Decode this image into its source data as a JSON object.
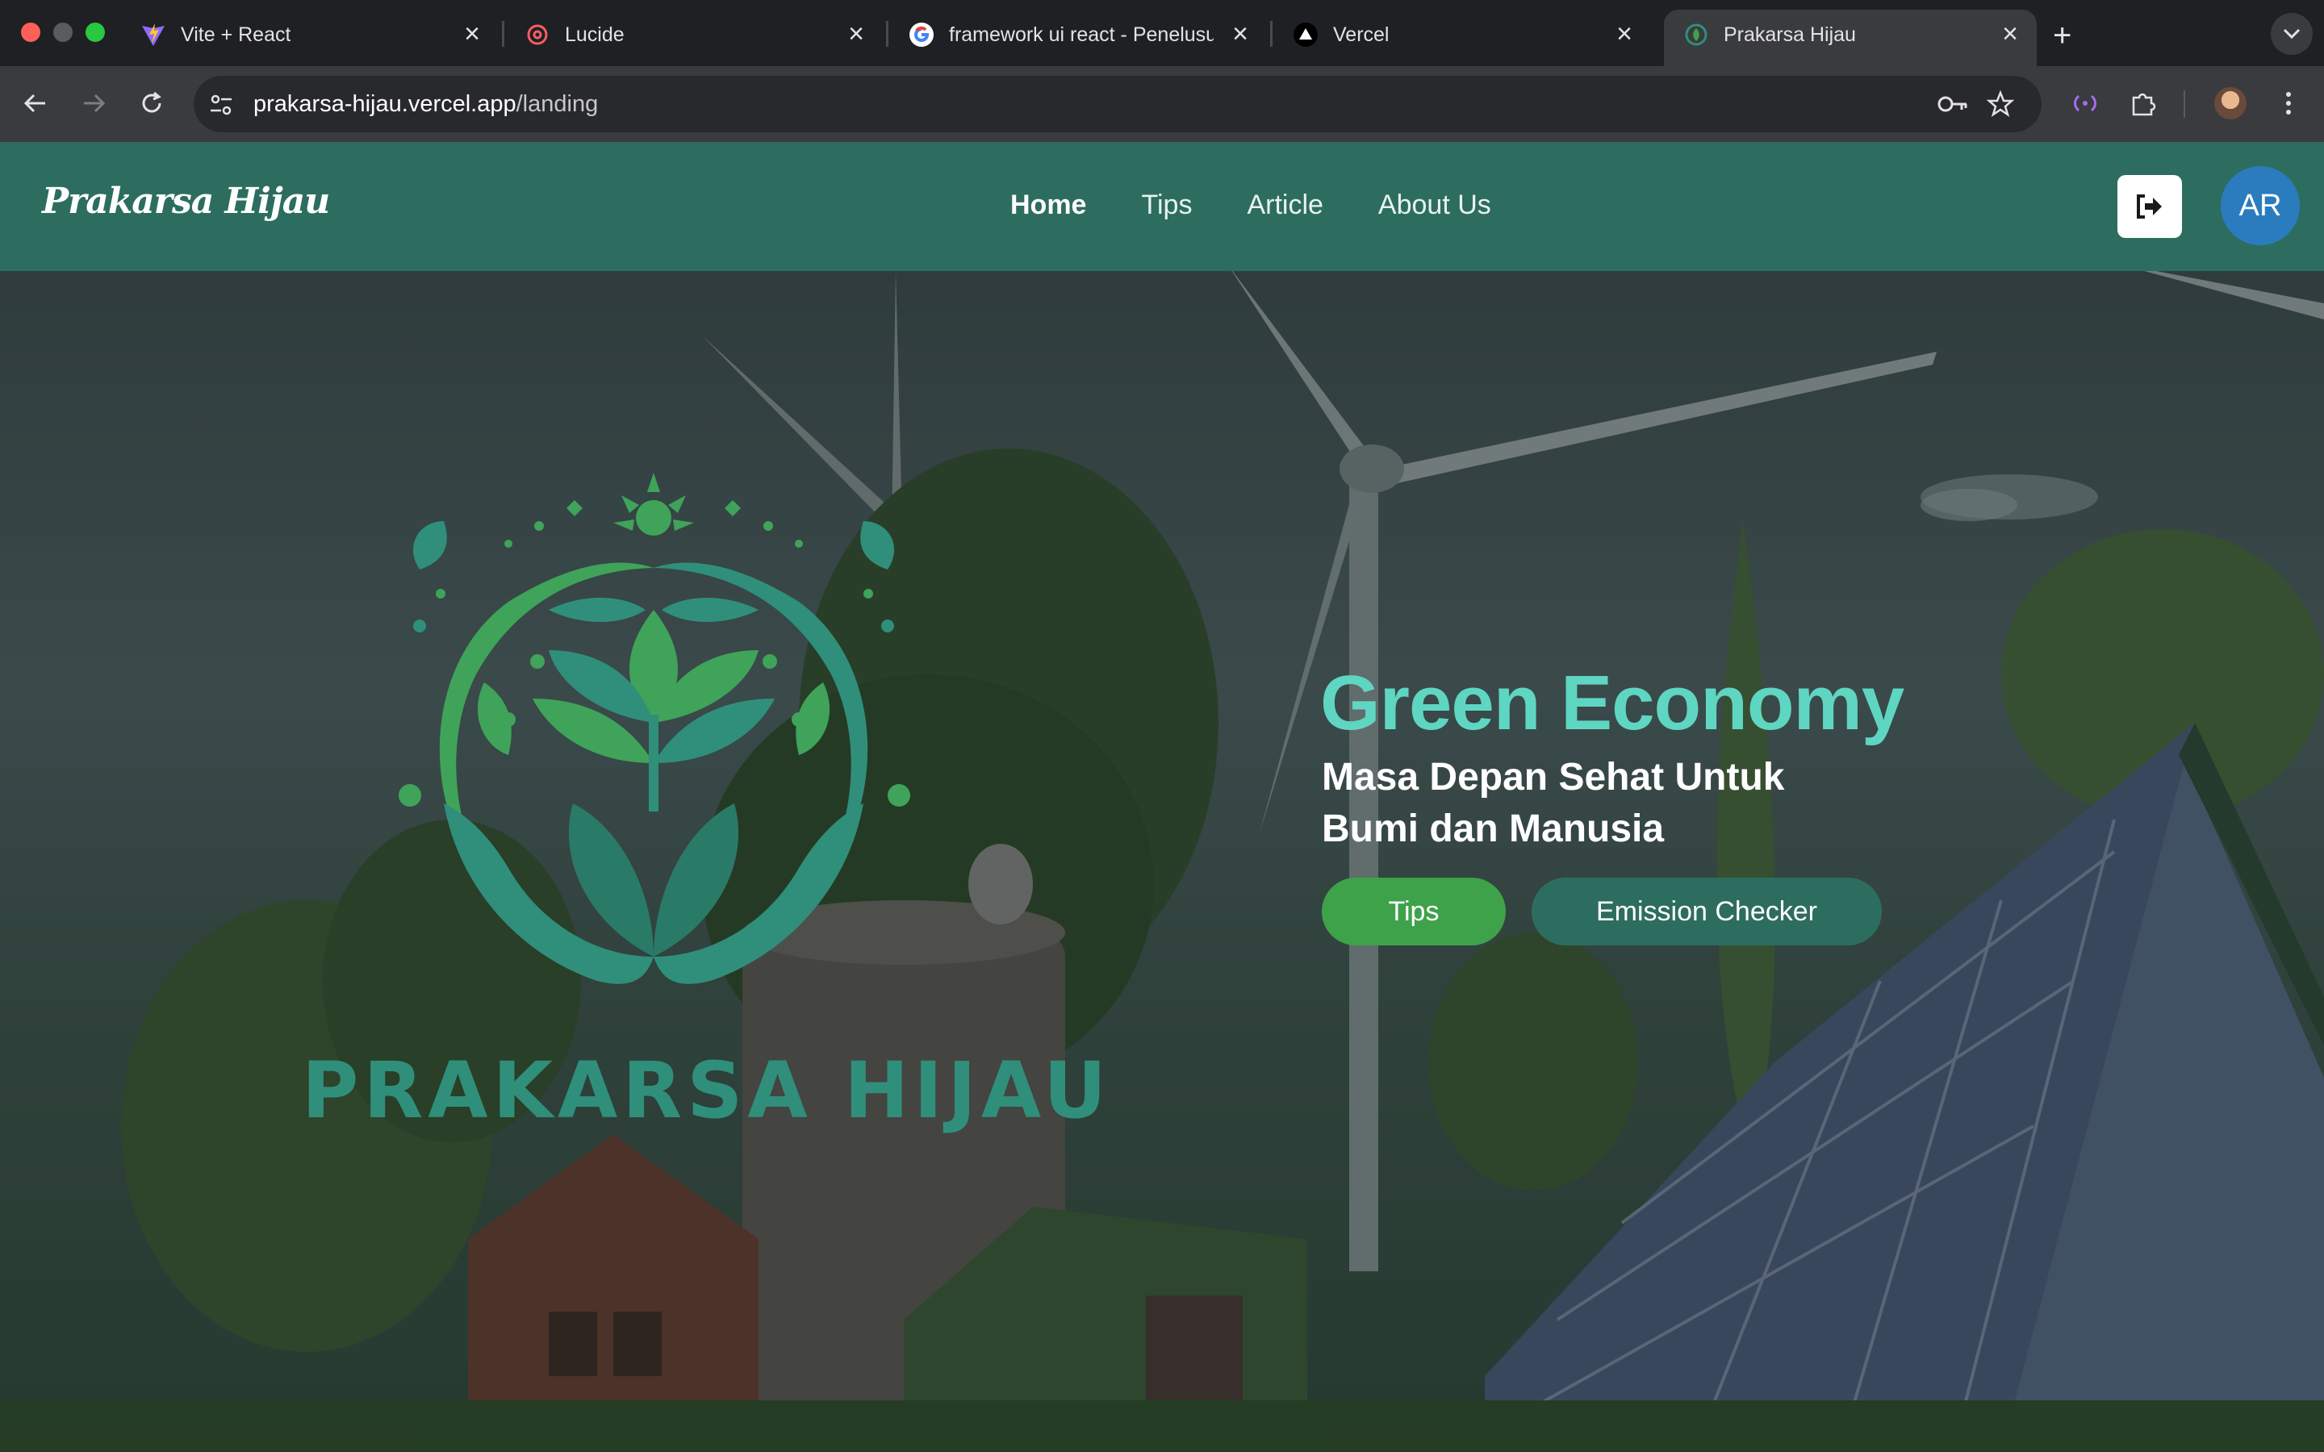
{
  "browser": {
    "tabs": [
      {
        "title": "Vite + React",
        "icon": "vite-icon",
        "active": false
      },
      {
        "title": "Lucide",
        "icon": "lucide-icon",
        "active": false
      },
      {
        "title": "framework ui react - Penelusuran Google",
        "icon": "google-icon",
        "active": false
      },
      {
        "title": "Vercel",
        "icon": "vercel-icon",
        "active": false
      },
      {
        "title": "Prakarsa Hijau",
        "icon": "prakarsa-hijau-favicon",
        "active": true
      }
    ],
    "url_host": "prakarsa-hijau.vercel.app",
    "url_path": "/landing"
  },
  "header": {
    "brand": "Prakarsa Hijau",
    "nav": [
      {
        "label": "Home",
        "active": true
      },
      {
        "label": "Tips",
        "active": false
      },
      {
        "label": "Article",
        "active": false
      },
      {
        "label": "About Us",
        "active": false
      }
    ],
    "avatar_initials": "AR",
    "logout_icon": "logout-icon",
    "colors": {
      "header_bg": "#2d6d5f",
      "avatar_bg": "#2b7cbf"
    }
  },
  "hero": {
    "logo_word1": "PRAKARSA",
    "logo_word2": "HIJAU",
    "title": "Green Economy",
    "subtitle": "Masa Depan Sehat Untuk Bumi dan Manusia",
    "buttons": {
      "tips": "Tips",
      "emission": "Emission Checker"
    },
    "colors": {
      "title": "#5fd6c1",
      "tips_btn": "#3ea24a",
      "emission_btn": "#2d6d5f"
    }
  }
}
